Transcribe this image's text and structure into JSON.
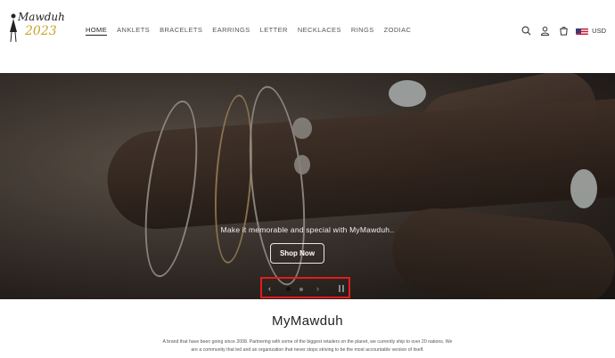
{
  "brand": {
    "logo_script": "Mawduh",
    "logo_year": "2023"
  },
  "nav": {
    "items": [
      {
        "label": "HOME",
        "active": true
      },
      {
        "label": "ANKLETS",
        "active": false
      },
      {
        "label": "BRACELETS",
        "active": false
      },
      {
        "label": "EARRINGS",
        "active": false
      },
      {
        "label": "LETTER",
        "active": false
      },
      {
        "label": "NECKLACES",
        "active": false
      },
      {
        "label": "RINGS",
        "active": false
      },
      {
        "label": "ZODIAC",
        "active": false
      }
    ]
  },
  "header_icons": [
    "search-icon",
    "account-icon",
    "cart-icon"
  ],
  "currency": {
    "label": "USD",
    "flag": "us-flag-icon"
  },
  "hero": {
    "tagline": "Make it memorable and special with MyMawduh..",
    "button_label": "Shop Now"
  },
  "slider": {
    "slide_count": 2,
    "active_slide": 1,
    "highlight_color": "#e51b1b"
  },
  "about": {
    "title": "MyMawduh",
    "text_line1": "A brand that have been going since 2008. Partnering with some of the biggest retailers on the planet, we currently ship to over 20 nations. We",
    "text_line2": "are a community that led and an organization that never stops striving to be the most accountable version of itself."
  }
}
